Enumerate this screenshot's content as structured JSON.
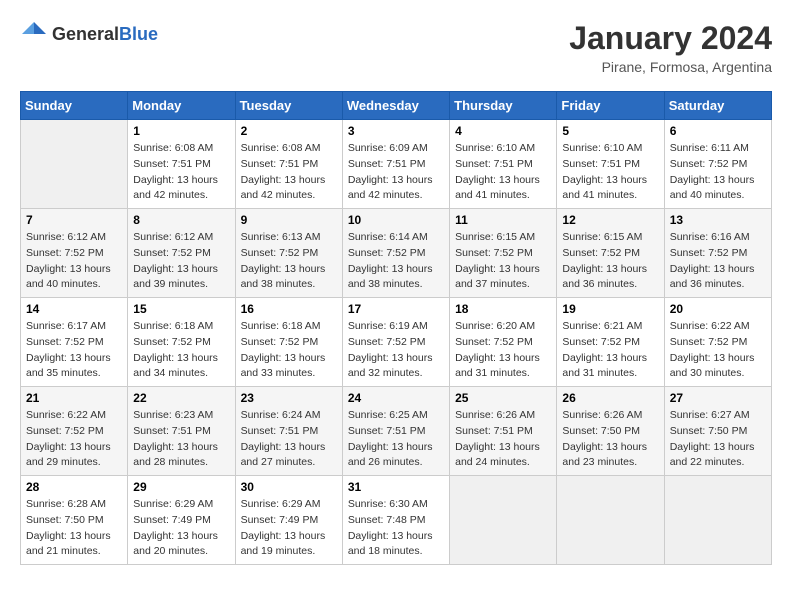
{
  "header": {
    "logo": {
      "general": "General",
      "blue": "Blue"
    },
    "title": "January 2024",
    "location": "Pirane, Formosa, Argentina"
  },
  "weekdays": [
    "Sunday",
    "Monday",
    "Tuesday",
    "Wednesday",
    "Thursday",
    "Friday",
    "Saturday"
  ],
  "weeks": [
    [
      {
        "day": "",
        "info": ""
      },
      {
        "day": "1",
        "info": "Sunrise: 6:08 AM\nSunset: 7:51 PM\nDaylight: 13 hours\nand 42 minutes."
      },
      {
        "day": "2",
        "info": "Sunrise: 6:08 AM\nSunset: 7:51 PM\nDaylight: 13 hours\nand 42 minutes."
      },
      {
        "day": "3",
        "info": "Sunrise: 6:09 AM\nSunset: 7:51 PM\nDaylight: 13 hours\nand 42 minutes."
      },
      {
        "day": "4",
        "info": "Sunrise: 6:10 AM\nSunset: 7:51 PM\nDaylight: 13 hours\nand 41 minutes."
      },
      {
        "day": "5",
        "info": "Sunrise: 6:10 AM\nSunset: 7:51 PM\nDaylight: 13 hours\nand 41 minutes."
      },
      {
        "day": "6",
        "info": "Sunrise: 6:11 AM\nSunset: 7:52 PM\nDaylight: 13 hours\nand 40 minutes."
      }
    ],
    [
      {
        "day": "7",
        "info": "Sunrise: 6:12 AM\nSunset: 7:52 PM\nDaylight: 13 hours\nand 40 minutes."
      },
      {
        "day": "8",
        "info": "Sunrise: 6:12 AM\nSunset: 7:52 PM\nDaylight: 13 hours\nand 39 minutes."
      },
      {
        "day": "9",
        "info": "Sunrise: 6:13 AM\nSunset: 7:52 PM\nDaylight: 13 hours\nand 38 minutes."
      },
      {
        "day": "10",
        "info": "Sunrise: 6:14 AM\nSunset: 7:52 PM\nDaylight: 13 hours\nand 38 minutes."
      },
      {
        "day": "11",
        "info": "Sunrise: 6:15 AM\nSunset: 7:52 PM\nDaylight: 13 hours\nand 37 minutes."
      },
      {
        "day": "12",
        "info": "Sunrise: 6:15 AM\nSunset: 7:52 PM\nDaylight: 13 hours\nand 36 minutes."
      },
      {
        "day": "13",
        "info": "Sunrise: 6:16 AM\nSunset: 7:52 PM\nDaylight: 13 hours\nand 36 minutes."
      }
    ],
    [
      {
        "day": "14",
        "info": "Sunrise: 6:17 AM\nSunset: 7:52 PM\nDaylight: 13 hours\nand 35 minutes."
      },
      {
        "day": "15",
        "info": "Sunrise: 6:18 AM\nSunset: 7:52 PM\nDaylight: 13 hours\nand 34 minutes."
      },
      {
        "day": "16",
        "info": "Sunrise: 6:18 AM\nSunset: 7:52 PM\nDaylight: 13 hours\nand 33 minutes."
      },
      {
        "day": "17",
        "info": "Sunrise: 6:19 AM\nSunset: 7:52 PM\nDaylight: 13 hours\nand 32 minutes."
      },
      {
        "day": "18",
        "info": "Sunrise: 6:20 AM\nSunset: 7:52 PM\nDaylight: 13 hours\nand 31 minutes."
      },
      {
        "day": "19",
        "info": "Sunrise: 6:21 AM\nSunset: 7:52 PM\nDaylight: 13 hours\nand 31 minutes."
      },
      {
        "day": "20",
        "info": "Sunrise: 6:22 AM\nSunset: 7:52 PM\nDaylight: 13 hours\nand 30 minutes."
      }
    ],
    [
      {
        "day": "21",
        "info": "Sunrise: 6:22 AM\nSunset: 7:52 PM\nDaylight: 13 hours\nand 29 minutes."
      },
      {
        "day": "22",
        "info": "Sunrise: 6:23 AM\nSunset: 7:51 PM\nDaylight: 13 hours\nand 28 minutes."
      },
      {
        "day": "23",
        "info": "Sunrise: 6:24 AM\nSunset: 7:51 PM\nDaylight: 13 hours\nand 27 minutes."
      },
      {
        "day": "24",
        "info": "Sunrise: 6:25 AM\nSunset: 7:51 PM\nDaylight: 13 hours\nand 26 minutes."
      },
      {
        "day": "25",
        "info": "Sunrise: 6:26 AM\nSunset: 7:51 PM\nDaylight: 13 hours\nand 24 minutes."
      },
      {
        "day": "26",
        "info": "Sunrise: 6:26 AM\nSunset: 7:50 PM\nDaylight: 13 hours\nand 23 minutes."
      },
      {
        "day": "27",
        "info": "Sunrise: 6:27 AM\nSunset: 7:50 PM\nDaylight: 13 hours\nand 22 minutes."
      }
    ],
    [
      {
        "day": "28",
        "info": "Sunrise: 6:28 AM\nSunset: 7:50 PM\nDaylight: 13 hours\nand 21 minutes."
      },
      {
        "day": "29",
        "info": "Sunrise: 6:29 AM\nSunset: 7:49 PM\nDaylight: 13 hours\nand 20 minutes."
      },
      {
        "day": "30",
        "info": "Sunrise: 6:29 AM\nSunset: 7:49 PM\nDaylight: 13 hours\nand 19 minutes."
      },
      {
        "day": "31",
        "info": "Sunrise: 6:30 AM\nSunset: 7:48 PM\nDaylight: 13 hours\nand 18 minutes."
      },
      {
        "day": "",
        "info": ""
      },
      {
        "day": "",
        "info": ""
      },
      {
        "day": "",
        "info": ""
      }
    ]
  ]
}
